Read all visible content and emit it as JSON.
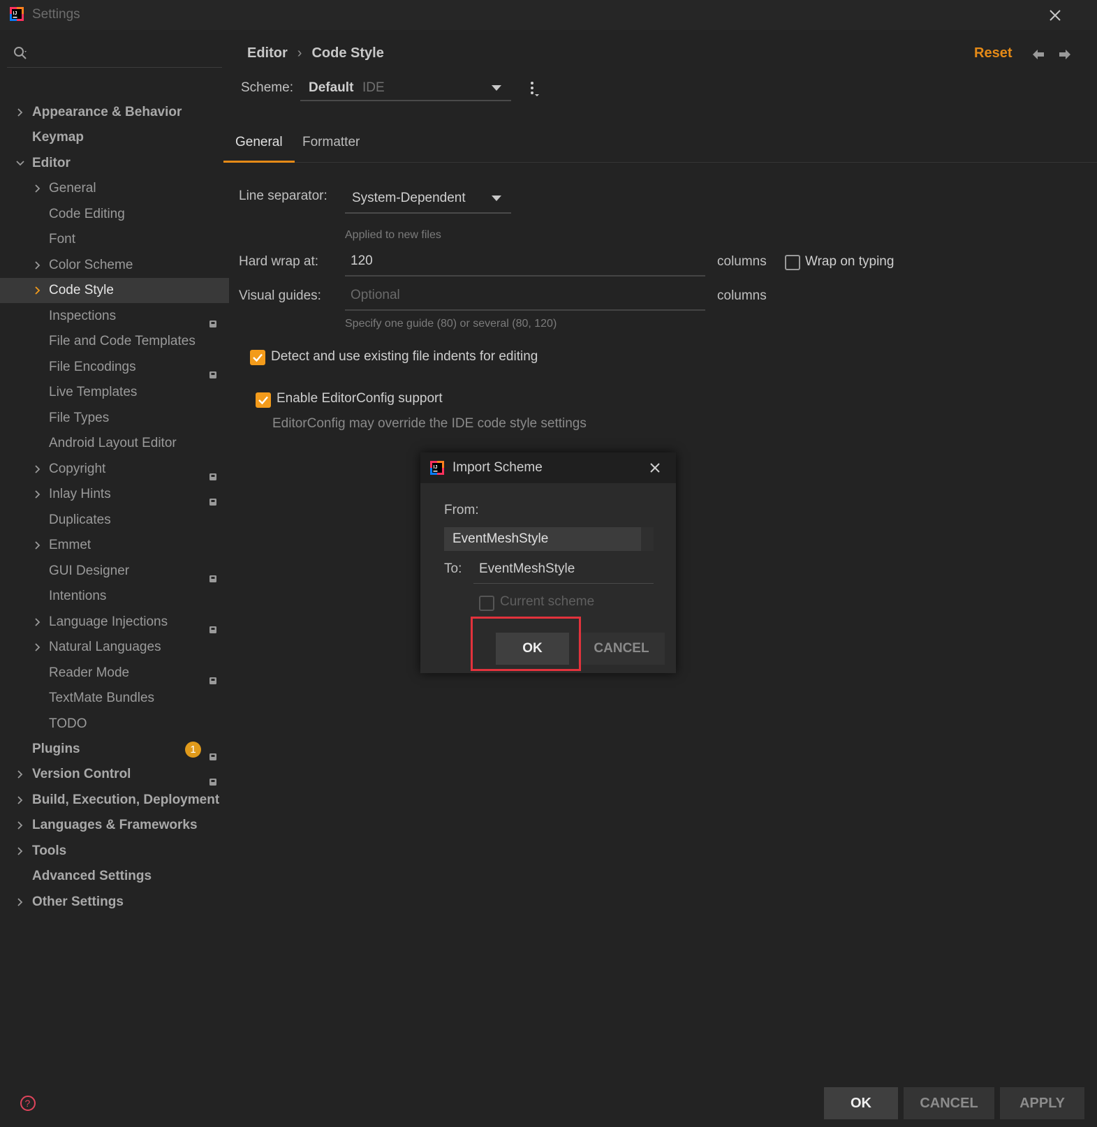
{
  "window": {
    "title": "Settings"
  },
  "search": {
    "placeholder": ""
  },
  "sidebar": {
    "items": [
      {
        "label": "Appearance & Behavior",
        "level": 0,
        "expandable": true
      },
      {
        "label": "Keymap",
        "level": 0,
        "expandable": false
      },
      {
        "label": "Editor",
        "level": 0,
        "expandable": true,
        "expanded": true
      },
      {
        "label": "General",
        "level": 1,
        "expandable": true
      },
      {
        "label": "Code Editing",
        "level": 1,
        "expandable": false
      },
      {
        "label": "Font",
        "level": 1,
        "expandable": false
      },
      {
        "label": "Color Scheme",
        "level": 1,
        "expandable": true
      },
      {
        "label": "Code Style",
        "level": 1,
        "expandable": true,
        "selected": true
      },
      {
        "label": "Inspections",
        "level": 1,
        "project": true
      },
      {
        "label": "File and Code Templates",
        "level": 1
      },
      {
        "label": "File Encodings",
        "level": 1,
        "project": true
      },
      {
        "label": "Live Templates",
        "level": 1
      },
      {
        "label": "File Types",
        "level": 1
      },
      {
        "label": "Android Layout Editor",
        "level": 1
      },
      {
        "label": "Copyright",
        "level": 1,
        "expandable": true,
        "project": true
      },
      {
        "label": "Inlay Hints",
        "level": 1,
        "expandable": true,
        "project": true
      },
      {
        "label": "Duplicates",
        "level": 1
      },
      {
        "label": "Emmet",
        "level": 1,
        "expandable": true
      },
      {
        "label": "GUI Designer",
        "level": 1,
        "project": true
      },
      {
        "label": "Intentions",
        "level": 1
      },
      {
        "label": "Language Injections",
        "level": 1,
        "expandable": true,
        "project": true
      },
      {
        "label": "Natural Languages",
        "level": 1,
        "expandable": true
      },
      {
        "label": "Reader Mode",
        "level": 1,
        "project": true
      },
      {
        "label": "TextMate Bundles",
        "level": 1
      },
      {
        "label": "TODO",
        "level": 1
      },
      {
        "label": "Plugins",
        "level": 0,
        "badge": "1",
        "project": true
      },
      {
        "label": "Version Control",
        "level": 0,
        "expandable": true,
        "project": true
      },
      {
        "label": "Build, Execution, Deployment",
        "level": 0,
        "expandable": true
      },
      {
        "label": "Languages & Frameworks",
        "level": 0,
        "expandable": true
      },
      {
        "label": "Tools",
        "level": 0,
        "expandable": true
      },
      {
        "label": "Advanced Settings",
        "level": 0
      },
      {
        "label": "Other Settings",
        "level": 0,
        "expandable": true
      }
    ]
  },
  "header": {
    "breadcrumb": [
      "Editor",
      "Code Style"
    ],
    "separator": "›",
    "reset_label": "Reset"
  },
  "scheme": {
    "label": "Scheme:",
    "name": "Default",
    "type": "IDE"
  },
  "tabs": [
    {
      "label": "General",
      "active": true
    },
    {
      "label": "Formatter",
      "active": false
    }
  ],
  "general": {
    "line_separator_label": "Line separator:",
    "line_separator_value": "System-Dependent",
    "line_separator_hint": "Applied to new files",
    "hard_wrap_label": "Hard wrap at:",
    "hard_wrap_value": "120",
    "columns_label": "columns",
    "wrap_on_typing_label": "Wrap on typing",
    "wrap_on_typing_checked": false,
    "visual_guides_label": "Visual guides:",
    "visual_guides_placeholder": "Optional",
    "visual_guides_columns": "columns",
    "visual_guides_hint": "Specify one guide (80) or several (80, 120)",
    "detect_indents_label": "Detect and use existing file indents for editing",
    "detect_indents_checked": true,
    "editorconfig_label": "Enable EditorConfig support",
    "editorconfig_checked": true,
    "editorconfig_hint": "EditorConfig may override the IDE code style settings"
  },
  "dialog": {
    "title": "Import Scheme",
    "from_label": "From:",
    "from_value": "EventMeshStyle",
    "to_label": "To:",
    "to_value": "EventMeshStyle",
    "current_scheme_label": "Current scheme",
    "ok_label": "OK",
    "cancel_label": "CANCEL"
  },
  "footer": {
    "ok_label": "OK",
    "cancel_label": "CANCEL",
    "apply_label": "APPLY"
  },
  "colors": {
    "accent": "#f39b1b",
    "highlight": "#e2323c",
    "background": "#232323"
  }
}
